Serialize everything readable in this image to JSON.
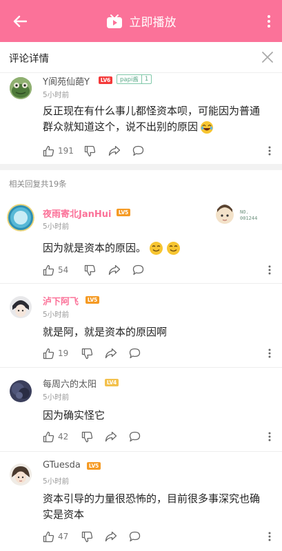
{
  "topbar": {
    "play_label": "立即播放",
    "color": "#fb7299"
  },
  "header": {
    "title": "评论详情"
  },
  "main_comment": {
    "username": "Y阆苑仙葩Y",
    "level": "LV6",
    "badge_name": "papi酱",
    "badge_level": "1",
    "time": "5小时前",
    "text_line1": "反正现在有什么事儿都怪资本呗，可能因为普通",
    "text_line2": "群众就知道这个，说不出别的原因",
    "likes": "191"
  },
  "replies_header": "相关回复共19条",
  "replies": [
    {
      "username": "夜雨寄北JanHui",
      "level": "LV5",
      "time": "5小时前",
      "text": "因为就是资本的原因。",
      "likes": "54",
      "decoration_line1": "NO.",
      "decoration_line2": "001244"
    },
    {
      "username": "泸下阿飞",
      "level": "LV5",
      "time": "5小时前",
      "text": "就是阿，就是资本的原因啊",
      "likes": "19"
    },
    {
      "username": "每周六的太阳",
      "level": "LV4",
      "time": "5小时前",
      "text": "因为确实怪它",
      "likes": "42"
    },
    {
      "username": "GTuesda",
      "level": "LV5",
      "time": "5小时前",
      "text_line1": "资本引导的力量很恐怖的，目前很多事深究也确",
      "text_line2": "实是资本",
      "likes": "47"
    }
  ],
  "icons": {
    "back": "back-arrow-icon",
    "play": "tv-play-icon",
    "more": "more-vertical-icon",
    "close": "close-icon",
    "like": "thumb-up-icon",
    "dislike": "thumb-down-icon",
    "share": "share-icon",
    "reply": "comment-icon"
  }
}
